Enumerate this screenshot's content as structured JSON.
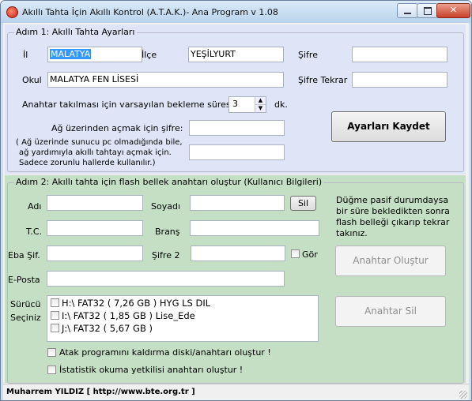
{
  "window": {
    "title": "Akıllı Tahta İçin Akıllı Kontrol (A.T.A.K.)- Ana Program v 1.08",
    "min_glyph": "",
    "max_glyph": "",
    "close_glyph": "✕"
  },
  "step1": {
    "title": "Adım 1: Akıllı Tahta Ayarları",
    "il_label": "İl",
    "il_value": "MALATYA",
    "ilce_label": "İlçe",
    "ilce_value": "YEŞİLYURT",
    "sifre_label": "Şifre",
    "sifre_value": "",
    "okul_label": "Okul",
    "okul_value": "MALATYA FEN LİSESİ",
    "sifre_tekrar_label": "Şifre Tekrar",
    "sifre_tekrar_value": "",
    "wait_label": "Anahtar takılması için varsayılan bekleme süresi",
    "wait_value": "3",
    "wait_unit": "dk.",
    "net_password_label": "Ağ üzerinden açmak için şifre:",
    "net_password_value": "",
    "net_password_confirm_value": "",
    "net_note_line1": "( Ağ üzerinde sunucu pc olmadığında bile,",
    "net_note_line2": "ağ yardımıyla akıllı tahtayı açmak için.",
    "net_note_line3": "Sadece zorunlu hallerde kullanılır.)",
    "save_button": "Ayarları Kaydet"
  },
  "step2": {
    "title": "Adım 2: Akıllı tahta için flash bellek anahtarı oluştur (Kullanıcı Bilgileri)",
    "ad_label": "Adı",
    "ad_value": "",
    "soyad_label": "Soyadı",
    "soyad_value": "",
    "sil_button": "Sil",
    "tc_label": "T.C.",
    "tc_value": "",
    "brans_label": "Branş",
    "brans_value": "",
    "eba_label": "Eba Şif.",
    "eba_value": "",
    "sifre2_label": "Şifre 2",
    "sifre2_value": "",
    "gor_label": "Gör",
    "eposta_label": "E-Posta",
    "eposta_value": "",
    "surucu_label_line1": "Sürücü",
    "surucu_label_line2": "Seçiniz",
    "drives": [
      "H:\\ FAT32 ( 7,26 GB ) HYG LS DIL",
      "I:\\ FAT32 ( 1,85 GB ) Lise_Ede",
      "J:\\ FAT32 ( 5,67 GB )"
    ],
    "hint_line1": "Düğme pasif durumdaysa",
    "hint_line2": "bir süre bekledikten sonra",
    "hint_line3": "flash belleği çıkarıp tekrar",
    "hint_line4": "takınız.",
    "create_key_button": "Anahtar Oluştur",
    "delete_key_button": "Anahtar Sil",
    "uninstall_option": "Atak programını kaldırma diski/anahtarı oluştur !",
    "stats_option": "İstatistik okuma yetkilisi anahtarı oluştur !"
  },
  "status": {
    "text": "Muharrem YILDIZ [ http://www.bte.org.tr ]"
  }
}
